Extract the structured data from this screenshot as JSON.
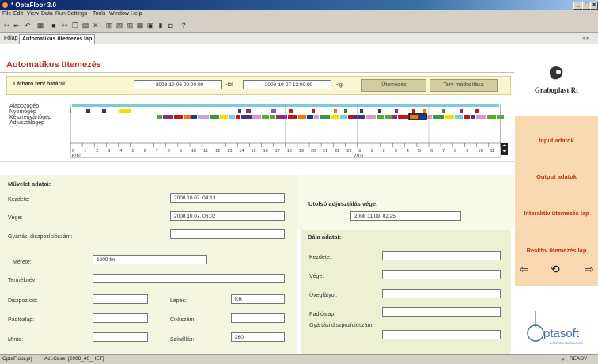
{
  "window": {
    "title": "* OptaFloor 3.0"
  },
  "menu": [
    "File",
    "Edit",
    "View",
    "Data",
    "Run",
    "Settings",
    "Tools",
    "Window",
    "Help"
  ],
  "tabs": [
    {
      "label": "Főlap"
    },
    {
      "label": "Automatikus ütemezés lap"
    }
  ],
  "page": {
    "title": "Automatikus ütemezés"
  },
  "plan": {
    "label": "Látható terv határai:",
    "from": "2008-10-06 00:00:00",
    "from_suffix": "-tól",
    "to": "2008-10-07 12:00:00",
    "to_suffix": "-ig",
    "schedule_button": "Ütemezés",
    "modify_button": "Terv módosítása"
  },
  "gantt": {
    "rows": [
      "Alapozógép",
      "Nyomógép",
      "Készregyártógép",
      "Adjusztálógép"
    ],
    "ticks_day1": [
      "0",
      "1",
      "2",
      "3",
      "4",
      "5",
      "6",
      "7",
      "8",
      "9",
      "10",
      "11",
      "12",
      "13",
      "14",
      "15",
      "16",
      "17",
      "18",
      "19",
      "20",
      "21",
      "22",
      "23"
    ],
    "ticks_day2": [
      "0",
      "1",
      "2",
      "3",
      "4",
      "5",
      "6",
      "7",
      "8",
      "9",
      "10",
      "11"
    ],
    "day1_label": "6/10",
    "day2_label": "7/10"
  },
  "muvelet": {
    "title": "Művelet adatai:",
    "start_label": "Kezdete:",
    "start_value": "2008 10.07. 04:13",
    "end_label": "Vége:",
    "end_value": "2008 10.07. 06:02",
    "disp_label": "Gyártási diszpozíciószám:",
    "disp_value": "",
    "size_label": "Mérete:",
    "size_value": "1200 fm",
    "product_label": "Terméknév:",
    "product_value": "",
    "dispo_label": "Diszpozíció:",
    "dispo_value": "",
    "step_label": "Lépés:",
    "step_value": "KR",
    "base_label": "Padlóalap:",
    "base_value": "",
    "item_label": "Cikkszám:",
    "item_value": "",
    "sample_label": "Minta:",
    "sample_value": "",
    "color_label": "Színállás:",
    "color_value": "260"
  },
  "utolso": {
    "label": "Utolsó adjusztálás vége:",
    "value": "2008 11.09. 02:25"
  },
  "bala": {
    "title": "Bála adatai:",
    "start_label": "Kezdete:",
    "end_label": "Vége:",
    "glass_label": "Üvegfátyol:",
    "base_label": "Padlóalap:",
    "disp_label": "Gyártási diszpozíciószám:"
  },
  "right": {
    "logo_text": "Graboplast Rt",
    "buttons": [
      "Input adatok",
      "Output adatok",
      "Interaktív ütemezés lap",
      "Reaktív ütemezés lap"
    ],
    "logo2_text": "ptasoft",
    "logo2_sub": "A BIZTOS MEGOLDÁS"
  },
  "status": {
    "project": "OptaFloor.prj",
    "case": "Act.Case: [2008_40_HET]",
    "ready": "READY"
  },
  "colors": {
    "heading": "#b8321e",
    "orange_panel": "#f8d8b0",
    "orange_text": "#c83010"
  }
}
